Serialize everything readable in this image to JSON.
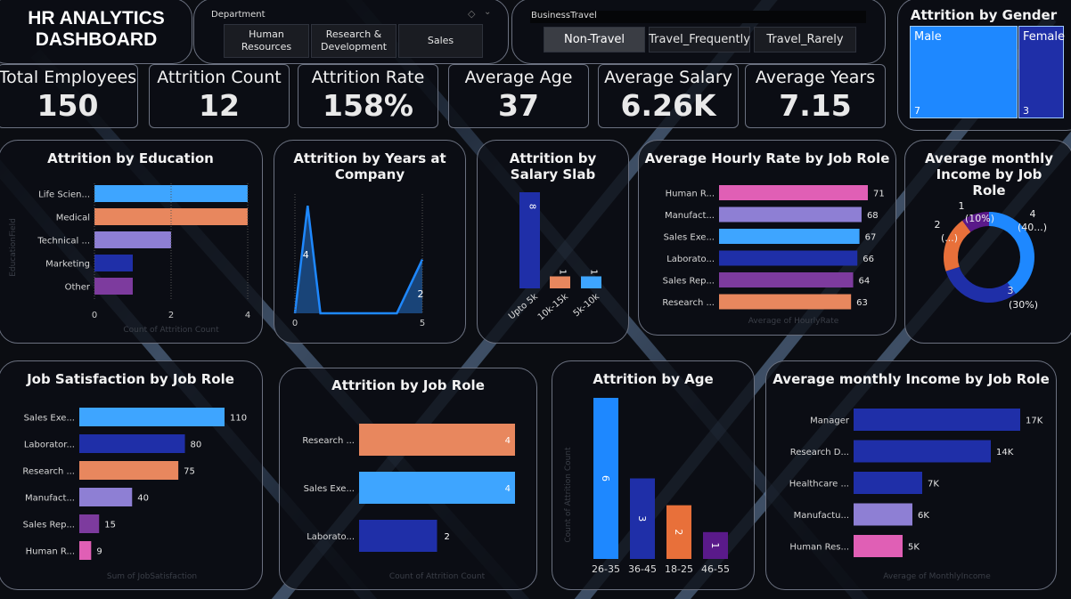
{
  "header": {
    "title_line1": "HR ANALYTICS",
    "title_line2": "DASHBOARD"
  },
  "department_slicer": {
    "label": "Department",
    "options": [
      "Human Resources",
      "Research & Development",
      "Sales"
    ]
  },
  "travel_slicer": {
    "label": "BusinessTravel",
    "options": [
      "Non-Travel",
      "Travel_Frequently",
      "Travel_Rarely"
    ],
    "selected": "Non-Travel"
  },
  "kpis": [
    {
      "label": "Total Employees",
      "value": "150"
    },
    {
      "label": "Attrition Count",
      "value": "12"
    },
    {
      "label": "Attrition Rate",
      "value": "158%"
    },
    {
      "label": "Average Age",
      "value": "37"
    },
    {
      "label": "Average Salary",
      "value": "6.26K"
    },
    {
      "label": "Average Years",
      "value": "7.15"
    }
  ],
  "colors": {
    "bg": "#0b0d12",
    "card_border": "#6b7180",
    "blue_light": "#3ea5ff",
    "blue_bright": "#1e88ff",
    "navy": "#1f2fa8",
    "orange": "#e8875e",
    "lavender": "#8e7fd4",
    "purple": "#7d3b9e",
    "pink": "#e05fb5",
    "dark_purple": "#5a1a8a"
  },
  "chart_data": [
    {
      "id": "gender",
      "type": "treemap",
      "title": "Attrition by Gender",
      "categories": [
        "Male",
        "Female"
      ],
      "values": [
        7,
        3
      ]
    },
    {
      "id": "education",
      "type": "bar",
      "orientation": "horizontal",
      "title": "Attrition by Education",
      "categories": [
        "Life Scien...",
        "Medical",
        "Technical ...",
        "Marketing",
        "Other"
      ],
      "values": [
        4,
        4,
        2,
        1,
        1
      ],
      "xlim": [
        0,
        4
      ],
      "xticks": [
        "0",
        "2",
        "4"
      ],
      "xlabel": "Count of Attrition Count",
      "ylabel": "EducationField"
    },
    {
      "id": "years",
      "type": "area",
      "title": "Attrition by Years at Company",
      "x": [
        0,
        0.5,
        1,
        2,
        3,
        4,
        5
      ],
      "values": [
        0,
        4,
        0,
        0,
        0,
        0,
        2
      ],
      "xticks": [
        "0",
        "5"
      ],
      "ylim": [
        0,
        4.5
      ],
      "data_labels": [
        {
          "x": 0.5,
          "value": "4"
        },
        {
          "x": 5,
          "value": "2"
        }
      ]
    },
    {
      "id": "salary",
      "type": "bar",
      "orientation": "vertical",
      "title": "Attrition by Salary Slab",
      "categories": [
        "Upto 5k",
        "10k-15k",
        "5k-10k"
      ],
      "values": [
        8,
        1,
        1
      ],
      "ylim": [
        0,
        8
      ]
    },
    {
      "id": "hourly",
      "type": "bar",
      "orientation": "horizontal",
      "title": "Average Hourly Rate by Job Role",
      "categories": [
        "Human R...",
        "Manufact...",
        "Sales Exe...",
        "Laborato...",
        "Sales Rep...",
        "Research ..."
      ],
      "values": [
        71,
        68,
        67,
        66,
        64,
        63
      ],
      "xlim": [
        0,
        71
      ],
      "xlabel": "Average of HourlyRate"
    },
    {
      "id": "donut",
      "type": "pie",
      "variant": "donut",
      "title": "Average monthly Income by Job Role",
      "values": [
        4,
        3,
        2,
        1
      ],
      "labels": [
        "4",
        "3",
        "2",
        "1"
      ],
      "pct_labels": [
        "(40...)",
        "(30%)",
        "(...)",
        "(10%)"
      ]
    },
    {
      "id": "satisfaction",
      "type": "bar",
      "orientation": "horizontal",
      "title": "Job Satisfaction by Job Role",
      "categories": [
        "Sales Exe...",
        "Laborator...",
        "Research ...",
        "Manufact...",
        "Sales Rep...",
        "Human R..."
      ],
      "values": [
        110,
        80,
        75,
        40,
        15,
        9
      ],
      "xlim": [
        0,
        110
      ],
      "xlabel": "Sum of JobSatisfaction"
    },
    {
      "id": "jobrole",
      "type": "bar",
      "orientation": "horizontal",
      "title": "Attrition by Job Role",
      "categories": [
        "Research ...",
        "Sales Exe...",
        "Laborato..."
      ],
      "values": [
        4,
        4,
        2
      ],
      "xlim": [
        0,
        4
      ],
      "xlabel": "Count of Attrition Count"
    },
    {
      "id": "age",
      "type": "bar",
      "orientation": "vertical",
      "title": "Attrition by Age",
      "categories": [
        "26-35",
        "36-45",
        "18-25",
        "46-55"
      ],
      "values": [
        6,
        3,
        2,
        1
      ],
      "ylim": [
        0,
        6
      ],
      "ylabel": "Count of Attrition Count"
    },
    {
      "id": "income",
      "type": "bar",
      "orientation": "horizontal",
      "title": "Average monthly Income by Job Role",
      "categories": [
        "Manager",
        "Research D...",
        "Healthcare ...",
        "Manufactu...",
        "Human Res..."
      ],
      "values": [
        17,
        14,
        7,
        6,
        5
      ],
      "value_labels": [
        "17K",
        "14K",
        "7K",
        "6K",
        "5K"
      ],
      "xlim": [
        0,
        17
      ],
      "xlabel": "Average of MonthlyIncome"
    }
  ]
}
